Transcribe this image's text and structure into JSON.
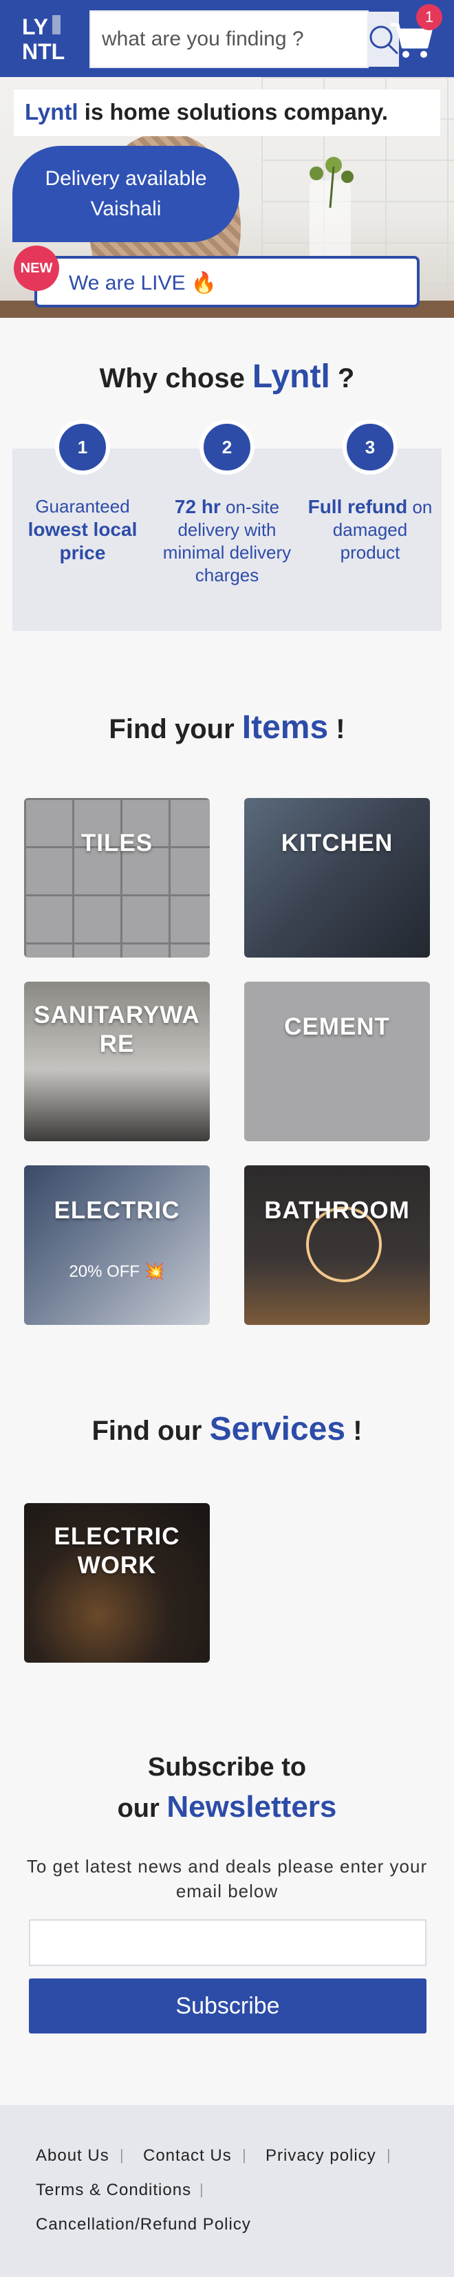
{
  "header": {
    "logo_text": "LYNTL",
    "search_placeholder": "what are you finding ?",
    "cart_count": "1"
  },
  "hero": {
    "tagline_brand": "Lyntl",
    "tagline_rest": " is home solutions company.",
    "delivery_line1": "Delivery available",
    "delivery_line2": "Vaishali",
    "new_badge": "NEW",
    "live_text": "We are LIVE 🔥"
  },
  "why": {
    "title_pre": "Why chose ",
    "title_brand": "Lyntl",
    "title_post": " ?",
    "items": [
      {
        "num": "1",
        "pre": "Guaranteed ",
        "bold": "lowest local price",
        "post": ""
      },
      {
        "num": "2",
        "pre": "",
        "bold": "72 hr",
        "post": " on-site delivery with minimal delivery charges"
      },
      {
        "num": "3",
        "pre": "",
        "bold": "Full refund",
        "post": " on damaged product"
      }
    ]
  },
  "items": {
    "title_pre": "Find your ",
    "title_hl": "Items",
    "title_post": " !",
    "categories": [
      "TILES",
      "KITCHEN",
      "SANITARYWARE",
      "CEMENT",
      "ELECTRIC",
      "BATHROOM"
    ],
    "electric_offer": "20% OFF 💥"
  },
  "services": {
    "title_pre": "Find our ",
    "title_hl": "Services",
    "title_post": " !",
    "list": [
      "ELECTRIC WORK"
    ]
  },
  "subscribe": {
    "title_line1": "Subscribe to",
    "title_line2_pre": "our ",
    "title_line2_hl": "Newsletters",
    "description": "To get latest news and deals please enter your email below",
    "input_value": "",
    "button_label": "Subscribe"
  },
  "footer": {
    "links": [
      "About Us",
      "Contact Us",
      "Privacy policy",
      "Terms & Conditions",
      "Cancellation/Refund Policy"
    ],
    "separator": "|"
  },
  "colors": {
    "brand_blue": "#2d4ca8",
    "badge_red": "#e5375a",
    "panel_grey": "#e7e8ee"
  }
}
